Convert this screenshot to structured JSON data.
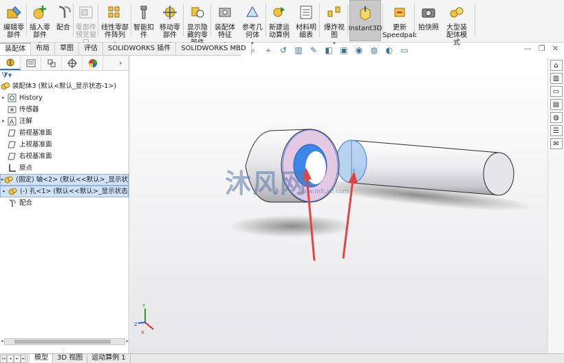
{
  "ribbon": {
    "buttons": [
      {
        "label": "编辑零\n部件",
        "icon": "edit-component-icon"
      },
      {
        "label": "插入零\n部件",
        "icon": "insert-components-icon",
        "dropdown": true
      },
      {
        "label": "配合",
        "icon": "mate-icon"
      },
      {
        "label": "零部件\n预览窗\n口",
        "icon": "component-preview-icon",
        "disabled": true
      },
      {
        "label": "线性零部\n件阵列",
        "icon": "linear-pattern-icon",
        "dropdown": true
      },
      {
        "label": "智能扣\n件",
        "icon": "smart-fasteners-icon"
      },
      {
        "label": "移动零\n部件",
        "icon": "move-component-icon",
        "dropdown": true
      },
      {
        "label": "显示隐\n藏的零\n部件",
        "icon": "show-hidden-icon"
      },
      {
        "label": "装配体\n特征",
        "icon": "assembly-features-icon",
        "dropdown": true
      },
      {
        "label": "参考几\n何体",
        "icon": "reference-geometry-icon",
        "dropdown": true
      },
      {
        "label": "新建运\n动算例",
        "icon": "new-motion-study-icon"
      },
      {
        "label": "材料明\n细表",
        "icon": "bill-of-materials-icon"
      },
      {
        "label": "爆炸视\n图",
        "icon": "exploded-view-icon",
        "dropdown": true
      },
      {
        "label": "Instant3D",
        "icon": "instant3d-icon",
        "active": true
      },
      {
        "label": "更新\nSpeedpak",
        "icon": "update-speedpak-icon"
      },
      {
        "label": "拍快照",
        "icon": "snapshot-icon"
      },
      {
        "label": "大型装\n配体模\n式",
        "icon": "large-assembly-icon"
      }
    ]
  },
  "tabs": [
    "装配体",
    "布局",
    "草图",
    "评估",
    "SOLIDWORKS 插件",
    "SOLIDWORKS MBD"
  ],
  "feature_tree": {
    "filter_icon": "funnel-icon",
    "root": "装配体3  (默认<默认_显示状态-1>)",
    "items": [
      {
        "label": "History",
        "expandable": true,
        "icon": "history-icon"
      },
      {
        "label": "传感器",
        "expandable": false,
        "icon": "sensor-icon"
      },
      {
        "label": "注解",
        "expandable": true,
        "icon": "annotation-icon"
      },
      {
        "label": "前视基准面",
        "expandable": false,
        "icon": "plane-icon"
      },
      {
        "label": "上视基准面",
        "expandable": false,
        "icon": "plane-icon"
      },
      {
        "label": "右视基准面",
        "expandable": false,
        "icon": "plane-icon"
      },
      {
        "label": "原点",
        "expandable": false,
        "icon": "origin-icon"
      },
      {
        "label": "(固定) 轴<2> (默认<<默认>_显示状",
        "expandable": true,
        "icon": "part-icon",
        "highlight": true
      },
      {
        "label": "(-) 孔<1> (默认<<默认>_显示状态",
        "expandable": true,
        "icon": "part-icon",
        "highlight": true
      },
      {
        "label": "配合",
        "expandable": false,
        "icon": "mates-folder-icon"
      }
    ]
  },
  "bottom_tabs": [
    "模型",
    "3D 视图",
    "运动算例 1"
  ],
  "watermark": {
    "text": "沐风网",
    "url": "www.mfcad.com"
  },
  "colors": {
    "ribbon_bg": "#f4f4f4",
    "highlight": "#cfe2f7",
    "accent": "#3a78c2",
    "arrow": "#e0453f"
  }
}
